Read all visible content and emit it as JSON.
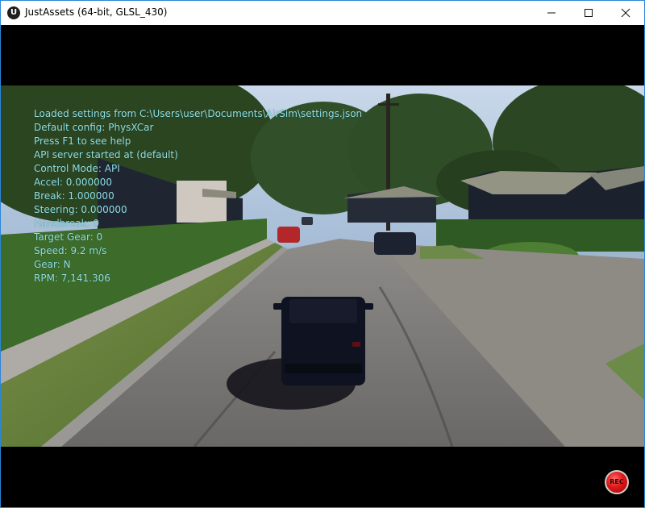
{
  "window": {
    "title": "JustAssets (64-bit, GLSL_430)",
    "app_icon": "unreal-engine-logo-icon",
    "controls": {
      "minimize": "minimize-icon",
      "maximize": "maximize-icon",
      "close": "close-icon"
    },
    "accent_color": "#2b86d9"
  },
  "hud": {
    "color": "#8ee0e6",
    "lines": [
      "Loaded settings from C:\\Users\\user\\Documents\\AirSim\\settings.json",
      "Default config: PhysXCar",
      "Press F1 to see help",
      "API server started at (default)",
      "Control Mode: API",
      "Accel: 0.000000",
      "Break: 1.000000",
      "Steering: 0.000000",
      "Handbreak: 0",
      "Target Gear: 0",
      "Speed: 9.2 m/s",
      "Gear: N",
      "RPM: 7,141.306"
    ]
  },
  "scene": {
    "description": "Suburban street rendered from behind a dark SUV; other cars ahead, houses, trees, hedges",
    "colors": {
      "sky": "#b9cbe0",
      "trees": "#2c4a22",
      "road": "#6f6d6b",
      "grass": "#5f7b3a",
      "sidewalk": "#b3b0aa",
      "car": "#111522",
      "red_car": "#b3272a"
    }
  },
  "record_button": {
    "label": "REC",
    "color": "#e01818"
  }
}
